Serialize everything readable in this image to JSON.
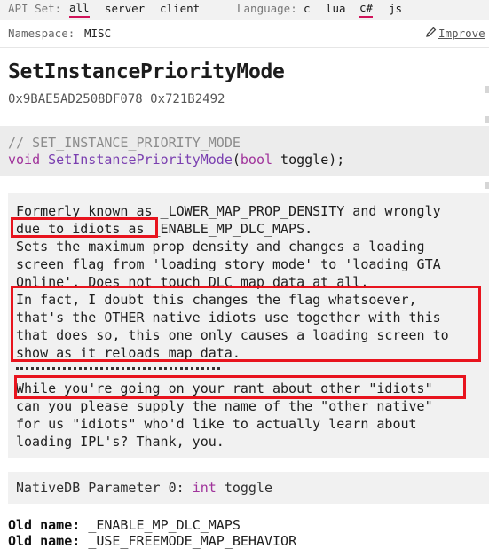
{
  "topbar": {
    "api_set_label": "API Set:",
    "api_sets": [
      "all",
      "server",
      "client"
    ],
    "language_label": "Language:",
    "languages": [
      "c",
      "lua",
      "c#",
      "js"
    ]
  },
  "namespace": {
    "label": "Namespace:",
    "value": "MISC",
    "improve": "Improve"
  },
  "native": {
    "name": "SetInstancePriorityMode",
    "hashes": "0x9BAE5AD2508DF078 0x721B2492",
    "comment": "// SET_INSTANCE_PRIORITY_MODE",
    "sig_void": "void",
    "sig_fn": "SetInstancePriorityMode",
    "sig_open": "(",
    "sig_type": "bool",
    "sig_rest": " toggle);"
  },
  "description": {
    "lines": [
      "Formerly known as _LOWER_MAP_PROP_DENSITY and wrongly",
      "due to idiots as _ENABLE_MP_DLC_MAPS.",
      "Sets the maximum prop density and changes a loading",
      "screen flag from 'loading story mode' to 'loading GTA",
      "Online'. Does not touch DLC map data at all.",
      "In fact, I doubt this changes the flag whatsoever,",
      "that's the OTHER native idiots use together with this",
      "that does so, this one only causes a loading screen to",
      "show as it reloads map data.",
      "",
      "While you're going on your rant about other \"idiots\"",
      "can you please supply the name of the \"other native\"",
      "for us \"idiots\" who'd like to actually learn about",
      "loading IPL's? Thank, you."
    ]
  },
  "parameter": {
    "prefix": "NativeDB Parameter 0:",
    "type": "int",
    "name": "toggle"
  },
  "old_names": [
    {
      "label": "Old name:",
      "value": "_ENABLE_MP_DLC_MAPS"
    },
    {
      "label": "Old name:",
      "value": "_USE_FREEMODE_MAP_BEHAVIOR"
    }
  ],
  "colors": {
    "highlight": "#e8141e",
    "active_tab": "#d0145a",
    "keyword": "#a0339b",
    "function": "#7a3fb0"
  },
  "icons": {
    "improve": "pencil-icon"
  }
}
